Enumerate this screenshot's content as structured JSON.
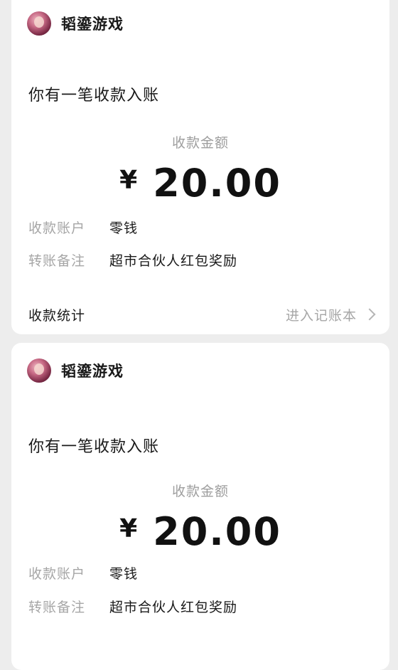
{
  "cards": [
    {
      "sender": "韬鎏游戏",
      "title": "你有一笔收款入账",
      "amount_label": "收款金额",
      "currency": "¥",
      "amount": "20.00",
      "account_key": "收款账户",
      "account_val": "零钱",
      "note_key": "转账备注",
      "note_val": "超市合伙人红包奖励",
      "footer_left": "收款统计",
      "footer_right": "进入记账本"
    },
    {
      "sender": "韬鎏游戏",
      "title": "你有一笔收款入账",
      "amount_label": "收款金额",
      "currency": "¥",
      "amount": "20.00",
      "account_key": "收款账户",
      "account_val": "零钱",
      "note_key": "转账备注",
      "note_val": "超市合伙人红包奖励"
    }
  ],
  "colors": {
    "page_bg": "#ededed",
    "card_bg": "#ffffff",
    "primary_text": "#191919",
    "secondary_text": "#a6a6a6"
  }
}
